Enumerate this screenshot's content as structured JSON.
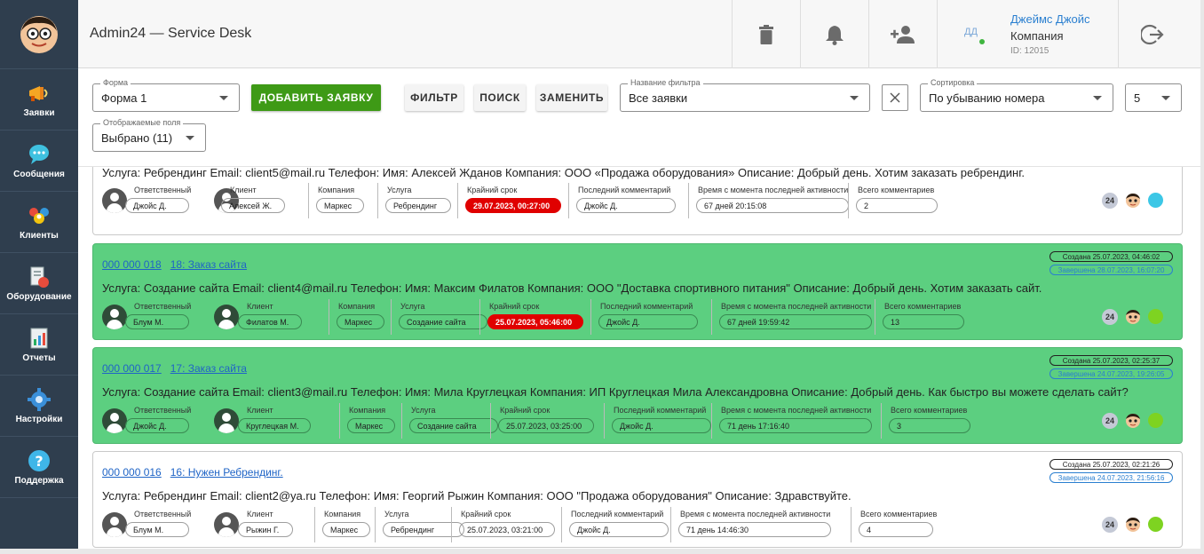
{
  "app": {
    "title": "Admin24 — Service Desk"
  },
  "sidebar": {
    "items": [
      {
        "label": "Заявки",
        "icon": "megaphone-icon"
      },
      {
        "label": "Сообщения",
        "icon": "chat-bubble-icon"
      },
      {
        "label": "Клиенты",
        "icon": "clients-icon"
      },
      {
        "label": "Оборудование",
        "icon": "equipment-icon"
      },
      {
        "label": "Отчеты",
        "icon": "report-icon"
      },
      {
        "label": "Настройки",
        "icon": "gear-icon"
      },
      {
        "label": "Поддержка",
        "icon": "help-icon"
      }
    ]
  },
  "header": {
    "user": {
      "initials": "ДД",
      "name": "Джеймс Джойс",
      "company": "Компания",
      "id": "ID: 12015"
    }
  },
  "toolbar": {
    "form": {
      "label": "Форма",
      "value": "Форма 1"
    },
    "add_button": "ДОБАВИТЬ ЗАЯВКУ",
    "filter_button": "ФИЛЬТР",
    "search_button": "ПОИСК",
    "replace_button": "ЗАМЕНИТЬ",
    "filter_name": {
      "label": "Название фильтра",
      "value": "Все заявки"
    },
    "sort": {
      "label": "Сортировка",
      "value": "По убыванию номера"
    },
    "per_page": "5",
    "fields": {
      "label": "Отображаемые поля",
      "value": "Выбрано (11)"
    }
  },
  "meta_labels": {
    "assignee": "Ответственный",
    "client": "Клиент",
    "company": "Компания",
    "service": "Услуга",
    "deadline": "Крайний срок",
    "last_comment": "Последний комментарий",
    "since_activity": "Время с момента последней активности",
    "total_comments": "Всего комментариев"
  },
  "colors": {
    "green": "#5ccf80",
    "red": "#e00000",
    "blue_link": "#1f64c6",
    "sidebar": "#2f3e4e",
    "button_green": "#3e9a16"
  },
  "tickets": [
    {
      "number": "",
      "title": "",
      "created": "",
      "finished": "",
      "description": "Услуга: Ребрендинг Email: client5@mail.ru Телефон: Имя: Алексей Жданов Компания: ООО «Продажа оборудования» Описание: Добрый день. Хотим заказать ребрендинг.",
      "assignee": "Джойс Д.",
      "client": "Алексей Ж.",
      "company": "Маркес",
      "service": "Ребрендинг",
      "deadline": "29.07.2023, 00:27:00",
      "last_comment": "Джойс Д.",
      "since_activity": "67 дней 20:15:08",
      "total_comments": "2",
      "badge": "24",
      "status_color": "#3cc7e6"
    },
    {
      "number": "000 000 018",
      "title": "18: Заказ сайта",
      "created": "Создана 25.07.2023, 04:46:02",
      "finished": "Завершена 28.07.2023, 16:07:20",
      "description": "Услуга: Создание сайта Email: client4@mail.ru Телефон: Имя: Максим Филатов Компания: ООО \"Доставка спортивного питания\" Описание: Добрый день. Хотим заказать сайт.",
      "assignee": "Блум М.",
      "client": "Филатов М.",
      "company": "Маркес",
      "service": "Создание сайта",
      "deadline": "25.07.2023, 05:46:00",
      "last_comment": "Джойс Д.",
      "since_activity": "67 дней 19:59:42",
      "total_comments": "13",
      "badge": "24",
      "status_color": "#7ed321"
    },
    {
      "number": "000 000 017",
      "title": "17: Заказ сайта",
      "created": "Создана 25.07.2023, 02:25:37",
      "finished": "Завершена 24.07.2023, 19:26:05",
      "description": "Услуга: Создание сайта Email: client3@mail.ru Телефон: Имя: Мила Круглецкая Компания: ИП Круглецкая Мила Александровна Описание: Добрый день. Как быстро вы можете сделать сайт?",
      "assignee": "Джойс Д.",
      "client": "Круглецкая М.",
      "company": "Маркес",
      "service": "Создание сайта",
      "deadline": "25.07.2023, 03:25:00",
      "last_comment": "Джойс Д.",
      "since_activity": "71 день 17:16:40",
      "total_comments": "3",
      "badge": "24",
      "status_color": "#7ed321"
    },
    {
      "number": "000 000 016",
      "title": "16: Нужен Ребрендинг.",
      "created": "Создана 25.07.2023, 02:21:26",
      "finished": "Завершена 24.07.2023, 21:56:16",
      "description": "Услуга: Ребрендинг Email: client2@ya.ru Телефон: Имя: Георгий Рыжин Компания: ООО \"Продажа оборудования\" Описание: Здравствуйте.",
      "assignee": "Блум М.",
      "client": "Рыжин Г.",
      "company": "Маркес",
      "service": "Ребрендинг",
      "deadline": "25.07.2023, 03:21:00",
      "last_comment": "Джойс Д.",
      "since_activity": "71 день 14:46:30",
      "total_comments": "4",
      "badge": "24",
      "status_color": "#7ed321"
    }
  ]
}
